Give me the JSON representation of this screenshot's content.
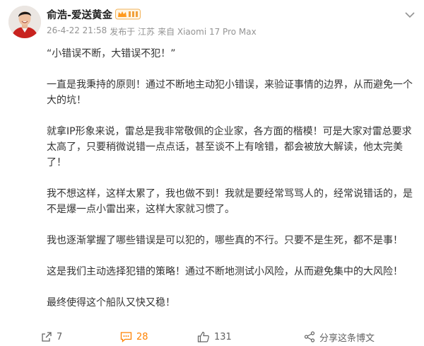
{
  "author": {
    "name": "俞浩-爱送黄金",
    "badge_icon": "vip-crown-icon"
  },
  "meta": {
    "time": "26-4-22 21:58",
    "location": "发布于 江苏",
    "source": "来自 Xiaomi 17 Pro Max"
  },
  "paragraphs": [
    "“小错误不断，大错误不犯！”",
    "一直是我秉持的原则！通过不断地主动犯小错误，来验证事情的边界，从而避免一个大的坑！",
    "就拿IP形象来说，雷总是我非常敬佩的企业家，各方面的楷模！可是大家对雷总要求太高了，只要稍微说错一点点话，甚至谈不上有啥错，都会被放大解读，他太完美了！",
    "我不想这样，这样太累了，我也做不到！我就是要经常骂骂人的，经常说错话的，是不是爆一点小雷出来，这样大家就习惯了。",
    "我也逐渐掌握了哪些错误是可以犯的，哪些真的不行。只要不是生死，都不是事！",
    "这是我们主动选择犯错的策略！通过不断地测试小风险，从而避免集中的大风险！",
    "最终使得这个船队又快又稳！"
  ],
  "actions": {
    "repost_count": "7",
    "comment_count": "28",
    "like_count": "131",
    "share_label": "分享这条博文"
  },
  "colors": {
    "accent": "#ff8200",
    "location": "#eb7350",
    "meta": "#939393"
  }
}
